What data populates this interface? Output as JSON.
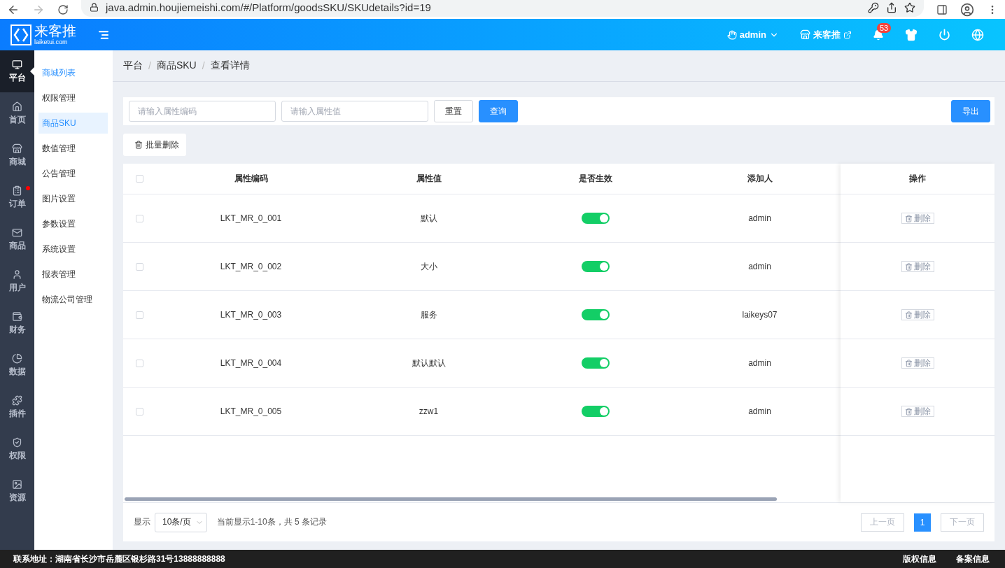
{
  "browser": {
    "url": "java.admin.houjiemeishi.com/#/Platform/goodsSKU/SKUdetails?id=19"
  },
  "header": {
    "logo_text": "来客推",
    "logo_sub": "laiketui.com",
    "user": "admin",
    "shop": "来客推",
    "notifications": "53"
  },
  "rail": [
    {
      "label": "平台",
      "selected": true,
      "dot": false
    },
    {
      "label": "首页",
      "selected": false,
      "dot": false
    },
    {
      "label": "商城",
      "selected": false,
      "dot": false
    },
    {
      "label": "订单",
      "selected": false,
      "dot": true
    },
    {
      "label": "商品",
      "selected": false,
      "dot": false
    },
    {
      "label": "用户",
      "selected": false,
      "dot": false
    },
    {
      "label": "财务",
      "selected": false,
      "dot": false
    },
    {
      "label": "数据",
      "selected": false,
      "dot": false
    },
    {
      "label": "插件",
      "selected": false,
      "dot": false
    },
    {
      "label": "权限",
      "selected": false,
      "dot": false
    },
    {
      "label": "资源",
      "selected": false,
      "dot": false
    }
  ],
  "submenu": [
    {
      "label": "商城列表",
      "selected": false,
      "highlighted": true
    },
    {
      "label": "权限管理",
      "selected": false,
      "highlighted": false
    },
    {
      "label": "商品SKU",
      "selected": true,
      "highlighted": false
    },
    {
      "label": "数值管理",
      "selected": false,
      "highlighted": false
    },
    {
      "label": "公告管理",
      "selected": false,
      "highlighted": false
    },
    {
      "label": "图片设置",
      "selected": false,
      "highlighted": false
    },
    {
      "label": "参数设置",
      "selected": false,
      "highlighted": false
    },
    {
      "label": "系统设置",
      "selected": false,
      "highlighted": false
    },
    {
      "label": "报表管理",
      "selected": false,
      "highlighted": false
    },
    {
      "label": "物流公司管理",
      "selected": false,
      "highlighted": false
    }
  ],
  "breadcrumb": [
    "平台",
    "商品SKU",
    "查看详情"
  ],
  "breadcrumb_separator": "/",
  "filters": {
    "code_placeholder": "请输入属性编码",
    "value_placeholder": "请输入属性值",
    "reset": "重置",
    "search": "查询",
    "export": "导出"
  },
  "bulk_delete": "批量删除",
  "table": {
    "all_checked": false,
    "columns": [
      "属性编码",
      "属性值",
      "是否生效",
      "添加人",
      "操作"
    ],
    "rows": [
      {
        "code": "LKT_MR_0_001",
        "value": "默认",
        "on": true,
        "added_by": "admin",
        "action": "删除",
        "checked": false
      },
      {
        "code": "LKT_MR_0_002",
        "value": "大小",
        "on": true,
        "added_by": "admin",
        "action": "删除",
        "checked": false
      },
      {
        "code": "LKT_MR_0_003",
        "value": "服务",
        "on": true,
        "added_by": "laikeys07",
        "action": "删除",
        "checked": false
      },
      {
        "code": "LKT_MR_0_004",
        "value": "默认默认",
        "on": true,
        "added_by": "admin",
        "action": "删除",
        "checked": false
      },
      {
        "code": "LKT_MR_0_005",
        "value": "zzw1",
        "on": true,
        "added_by": "admin",
        "action": "删除",
        "checked": false
      }
    ]
  },
  "pagination": {
    "show_label": "显示",
    "page_size": "10条/页",
    "summary": "当前显示1-10条，共 5 条记录",
    "prev": "上一页",
    "pages": [
      {
        "label": "1",
        "selected": true
      }
    ],
    "next": "下一页"
  },
  "footer": {
    "address": "联系地址：湖南省长沙市岳麓区银杉路31号13888888888",
    "links": [
      "版权信息",
      "备案信息"
    ]
  }
}
